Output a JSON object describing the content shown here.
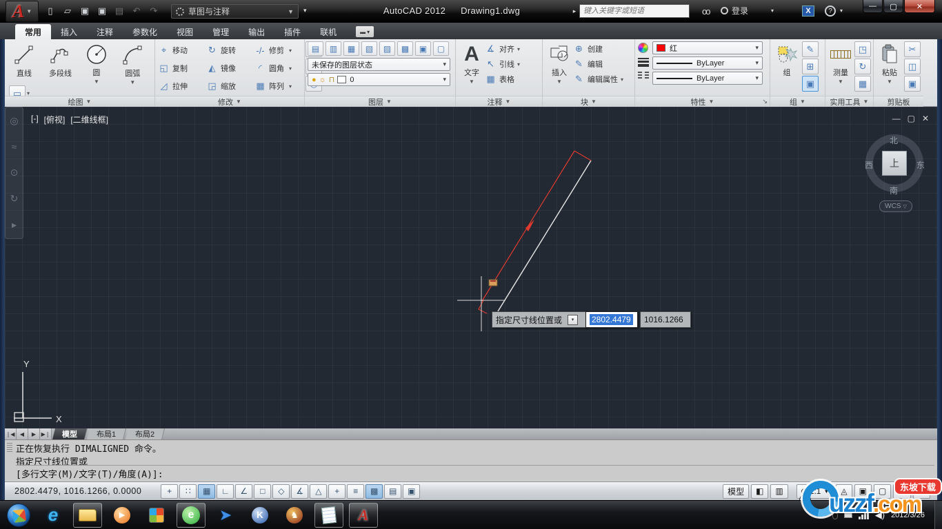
{
  "titlebar": {
    "workspace": "草图与注释",
    "app_title": "AutoCAD 2012",
    "doc_title": "Drawing1.dwg",
    "search_placeholder": "键入关键字或短语",
    "signin_label": "登录"
  },
  "ribbon_tabs": {
    "items": [
      "常用",
      "插入",
      "注释",
      "参数化",
      "视图",
      "管理",
      "输出",
      "插件",
      "联机"
    ]
  },
  "panels": {
    "draw": {
      "label": "绘图",
      "tools": [
        "直线",
        "多段线",
        "圆",
        "圆弧"
      ]
    },
    "modify": {
      "label": "修改",
      "tools": [
        "移动",
        "旋转",
        "修剪",
        "复制",
        "镜像",
        "圆角",
        "拉伸",
        "缩放",
        "阵列"
      ]
    },
    "layers": {
      "label": "图层",
      "state_dropdown": "未保存的图层状态",
      "current_layer": "0"
    },
    "annotate": {
      "label": "注释",
      "text_tool": "文字",
      "tools": [
        "对齐",
        "引线",
        "表格"
      ]
    },
    "block": {
      "label": "块",
      "insert_tool": "插入",
      "tools": [
        "创建",
        "编辑",
        "编辑属性"
      ]
    },
    "properties": {
      "label": "特性",
      "color": "红",
      "lineweight": "ByLayer",
      "linetype": "ByLayer"
    },
    "groups": {
      "label": "组",
      "group_tool": "组"
    },
    "utilities": {
      "label": "实用工具",
      "measure_tool": "测量"
    },
    "clipboard": {
      "label": "剪贴板",
      "paste_tool": "粘贴"
    }
  },
  "viewport": {
    "control_minus": "[-]",
    "control_view": "[俯视]",
    "control_visual": "[二维线框]",
    "viewcube": {
      "north": "北",
      "south": "南",
      "east": "东",
      "west": "西",
      "top": "上",
      "wcs": "WCS"
    }
  },
  "dynamic_input": {
    "prompt": "指定尺寸线位置或",
    "x_value": "2802.4479",
    "y_value": "1016.1266"
  },
  "ucs": {
    "x_label": "X",
    "y_label": "Y"
  },
  "layout_tabs": {
    "model": "模型",
    "layout1": "布局1",
    "layout2": "布局2"
  },
  "command_line": {
    "history1": "正在恢复执行 DIMALIGNED 命令。",
    "history2": "指定尺寸线位置或",
    "prompt": "[多行文字(M)/文字(T)/角度(A)]:"
  },
  "status_bar": {
    "coordinates": "2802.4479,  1016.1266,  0.0000",
    "model_button": "模型",
    "annotation_scale": "1:1"
  },
  "taskbar": {
    "date": "2012/3/26"
  },
  "watermark": {
    "main": "uzzf",
    "suffix": ".com",
    "badge": "东坡下载"
  },
  "colors": {
    "current_color_red": "#ff0000",
    "selection_blue": "#3577d4",
    "canvas_background": "#232932",
    "dimension_preview_red": "#e03a2f"
  }
}
